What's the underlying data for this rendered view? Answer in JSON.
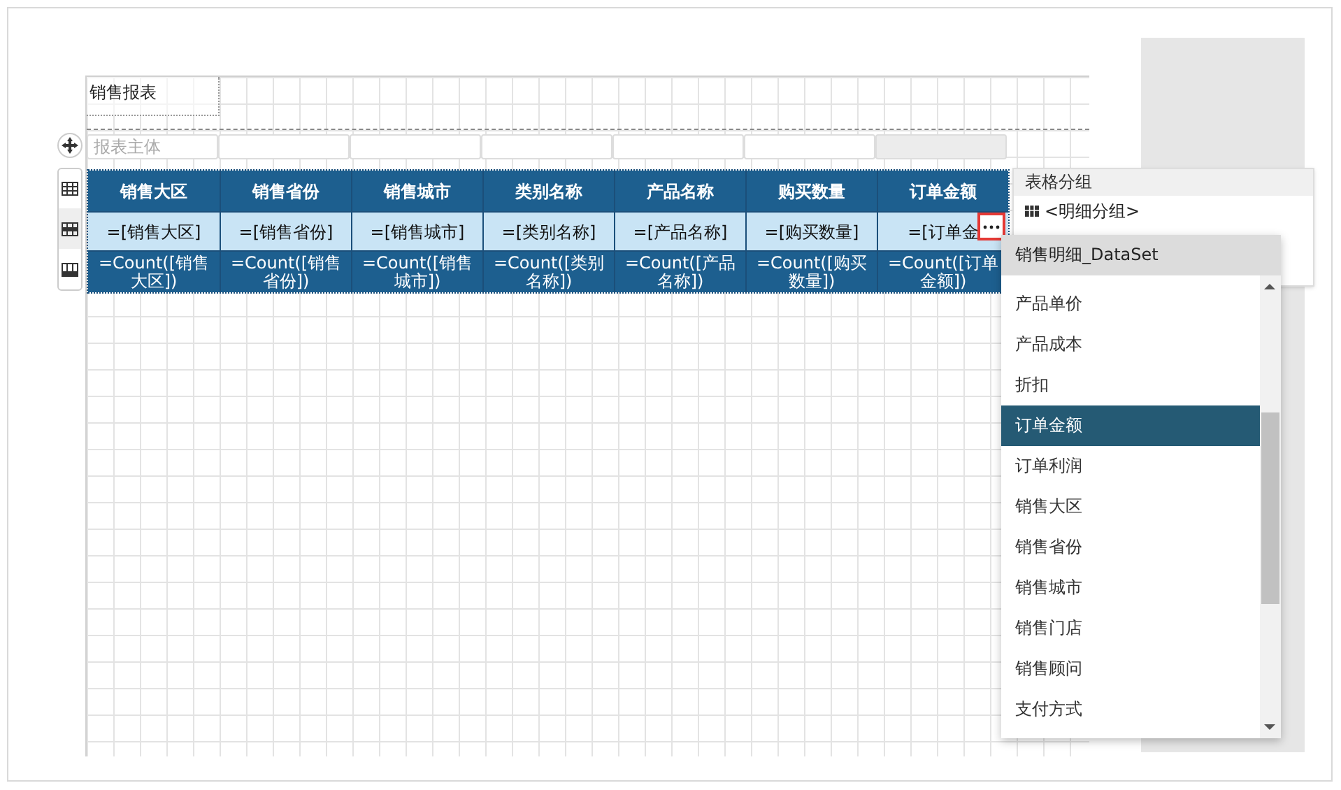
{
  "report_title": "销售报表",
  "body_label": "报表主体",
  "columns": [
    {
      "header": "销售大区",
      "field": "=[销售大区]",
      "total": "=Count([销售大区])"
    },
    {
      "header": "销售省份",
      "field": "=[销售省份]",
      "total": "=Count([销售省份])"
    },
    {
      "header": "销售城市",
      "field": "=[销售城市]",
      "total": "=Count([销售城市])"
    },
    {
      "header": "类别名称",
      "field": "=[类别名称]",
      "total": "=Count([类别名称])"
    },
    {
      "header": "产品名称",
      "field": "=[产品名称]",
      "total": "=Count([产品名称])"
    },
    {
      "header": "购买数量",
      "field": "=[购买数量]",
      "total": "=Count([购买数量])"
    },
    {
      "header": "订单金额",
      "field": "=[订单金",
      "total": "=Count([订单金额])"
    }
  ],
  "group_panel": {
    "title": "表格分组",
    "items": [
      "<明细分组>"
    ]
  },
  "field_dropdown": {
    "dataset": "销售明细_DataSet",
    "items": [
      {
        "label": "产品单价",
        "selected": false
      },
      {
        "label": "产品成本",
        "selected": false
      },
      {
        "label": "折扣",
        "selected": false
      },
      {
        "label": "订单金额",
        "selected": true
      },
      {
        "label": "订单利润",
        "selected": false
      },
      {
        "label": "销售大区",
        "selected": false
      },
      {
        "label": "销售省份",
        "selected": false
      },
      {
        "label": "销售城市",
        "selected": false
      },
      {
        "label": "销售门店",
        "selected": false
      },
      {
        "label": "销售顾问",
        "selected": false
      },
      {
        "label": "支付方式",
        "selected": false
      }
    ]
  }
}
